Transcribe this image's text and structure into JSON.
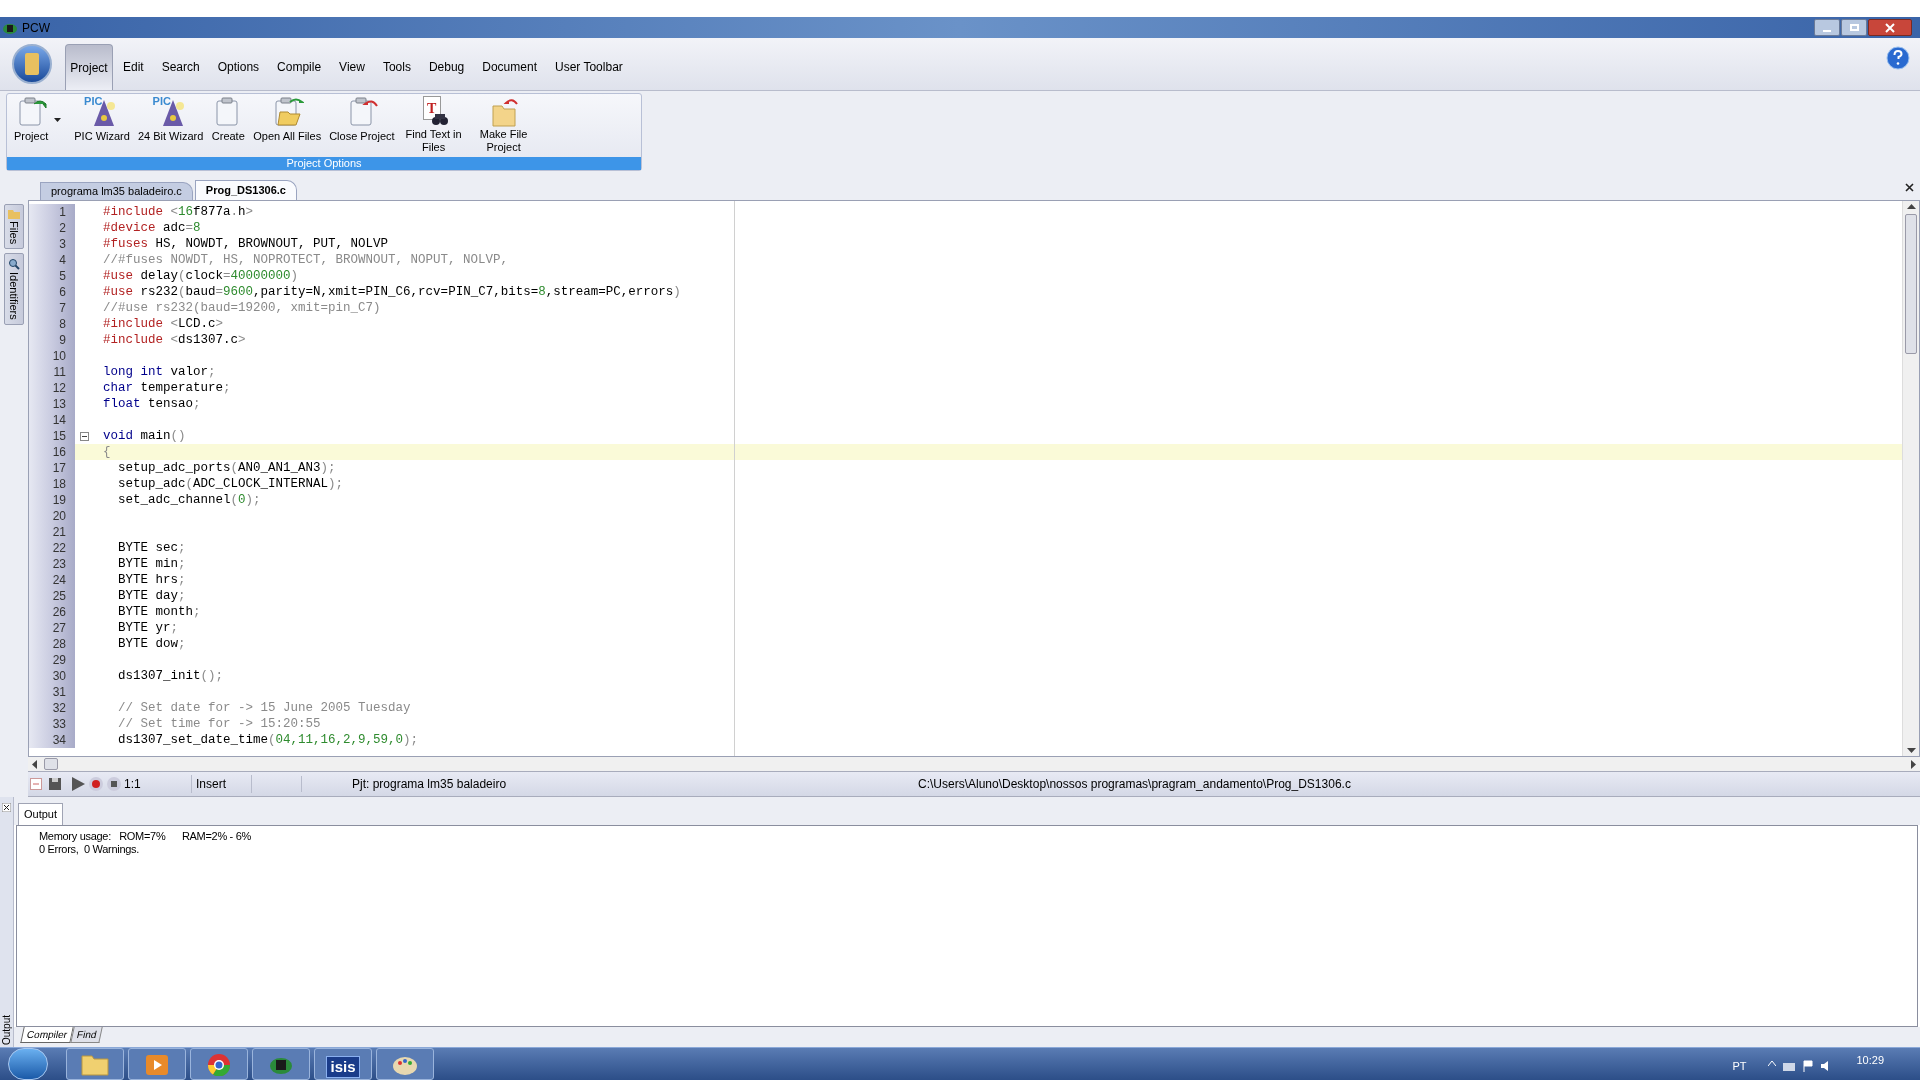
{
  "window": {
    "title": "PCW"
  },
  "ribbon_tabs": [
    {
      "label": "Project",
      "selected": true
    },
    {
      "label": "Edit",
      "selected": false
    },
    {
      "label": "Search",
      "selected": false
    },
    {
      "label": "Options",
      "selected": false
    },
    {
      "label": "Compile",
      "selected": false
    },
    {
      "label": "View",
      "selected": false
    },
    {
      "label": "Tools",
      "selected": false
    },
    {
      "label": "Debug",
      "selected": false
    },
    {
      "label": "Document",
      "selected": false
    },
    {
      "label": "User Toolbar",
      "selected": false
    }
  ],
  "ribbon_group": {
    "label": "Project Options",
    "buttons": [
      {
        "kind": "project",
        "label": "Project",
        "dropdown": true
      },
      {
        "kind": "wizard",
        "label": "PIC Wizard",
        "dropdown": false,
        "badge": "PIC"
      },
      {
        "kind": "wizard",
        "label": "24 Bit Wizard",
        "dropdown": false,
        "badge": "PIC"
      },
      {
        "kind": "create",
        "label": "Create",
        "dropdown": false
      },
      {
        "kind": "open",
        "label": "Open All Files",
        "dropdown": false
      },
      {
        "kind": "close",
        "label": "Close Project",
        "dropdown": false
      },
      {
        "kind": "find",
        "label": "Find Text in Files",
        "dropdown": false,
        "badge": "T"
      },
      {
        "kind": "make",
        "label": "Make File Project",
        "dropdown": false
      }
    ]
  },
  "side_tabs": [
    "Files",
    "Identifiers"
  ],
  "doc_tabs": [
    {
      "label": "programa lm35 baladeiro.c",
      "selected": false
    },
    {
      "label": "Prog_DS1306.c",
      "selected": true
    }
  ],
  "code": [
    {
      "n": "1",
      "current": false,
      "fold": false,
      "tokens": [
        {
          "kind": "dir",
          "t": "#include"
        },
        {
          "kind": "op",
          "t": " <"
        },
        {
          "kind": "num",
          "t": "16"
        },
        {
          "kind": "txt",
          "t": "f877a"
        },
        {
          "kind": "op",
          "t": "."
        },
        {
          "kind": "txt",
          "t": "h"
        },
        {
          "kind": "op",
          "t": ">"
        }
      ]
    },
    {
      "n": "2",
      "current": false,
      "fold": false,
      "tokens": [
        {
          "kind": "dir",
          "t": "#device"
        },
        {
          "kind": "txt",
          "t": " adc"
        },
        {
          "kind": "op",
          "t": "="
        },
        {
          "kind": "num",
          "t": "8"
        }
      ]
    },
    {
      "n": "3",
      "current": false,
      "fold": false,
      "tokens": [
        {
          "kind": "dir",
          "t": "#fuses"
        },
        {
          "kind": "txt",
          "t": " HS, NOWDT, BROWNOUT, PUT, NOLVP"
        }
      ]
    },
    {
      "n": "4",
      "current": false,
      "fold": false,
      "tokens": [
        {
          "kind": "com",
          "t": "//#fuses NOWDT, HS, NOPROTECT, BROWNOUT, NOPUT, NOLVP,"
        }
      ]
    },
    {
      "n": "5",
      "current": false,
      "fold": false,
      "tokens": [
        {
          "kind": "dir",
          "t": "#use"
        },
        {
          "kind": "txt",
          "t": " delay"
        },
        {
          "kind": "op",
          "t": "("
        },
        {
          "kind": "txt",
          "t": "clock"
        },
        {
          "kind": "op",
          "t": "="
        },
        {
          "kind": "num",
          "t": "40000000"
        },
        {
          "kind": "op",
          "t": ")"
        }
      ]
    },
    {
      "n": "6",
      "current": false,
      "fold": false,
      "tokens": [
        {
          "kind": "dir",
          "t": "#use"
        },
        {
          "kind": "txt",
          "t": " rs232"
        },
        {
          "kind": "op",
          "t": "("
        },
        {
          "kind": "txt",
          "t": "baud"
        },
        {
          "kind": "op",
          "t": "="
        },
        {
          "kind": "num",
          "t": "9600"
        },
        {
          "kind": "txt",
          "t": ",parity=N,xmit=PIN_C6,rcv=PIN_C7,bits="
        },
        {
          "kind": "num",
          "t": "8"
        },
        {
          "kind": "txt",
          "t": ",stream=PC,errors"
        },
        {
          "kind": "op",
          "t": ")"
        }
      ]
    },
    {
      "n": "7",
      "current": false,
      "fold": false,
      "tokens": [
        {
          "kind": "com",
          "t": "//#use rs232(baud=19200, xmit=pin_C7)"
        }
      ]
    },
    {
      "n": "8",
      "current": false,
      "fold": false,
      "tokens": [
        {
          "kind": "dir",
          "t": "#include"
        },
        {
          "kind": "op",
          "t": " <"
        },
        {
          "kind": "txt",
          "t": "LCD.c"
        },
        {
          "kind": "op",
          "t": ">"
        }
      ]
    },
    {
      "n": "9",
      "current": false,
      "fold": false,
      "tokens": [
        {
          "kind": "dir",
          "t": "#include"
        },
        {
          "kind": "op",
          "t": " <"
        },
        {
          "kind": "txt",
          "t": "ds1307.c"
        },
        {
          "kind": "op",
          "t": ">"
        }
      ]
    },
    {
      "n": "10",
      "current": false,
      "fold": false
    },
    {
      "n": "11",
      "current": false,
      "fold": false,
      "tokens": [
        {
          "kind": "kw",
          "t": "long"
        },
        {
          "kind": "kw",
          "t": " int"
        },
        {
          "kind": "txt",
          "t": " valor"
        },
        {
          "kind": "op",
          "t": ";"
        }
      ]
    },
    {
      "n": "12",
      "current": false,
      "fold": false,
      "tokens": [
        {
          "kind": "kw",
          "t": "char"
        },
        {
          "kind": "txt",
          "t": " temperature"
        },
        {
          "kind": "op",
          "t": ";"
        }
      ]
    },
    {
      "n": "13",
      "current": false,
      "fold": false,
      "tokens": [
        {
          "kind": "kw",
          "t": "float"
        },
        {
          "kind": "txt",
          "t": " tensao"
        },
        {
          "kind": "op",
          "t": ";"
        }
      ]
    },
    {
      "n": "14",
      "current": false,
      "fold": false
    },
    {
      "n": "15",
      "current": false,
      "fold": true,
      "tokens": [
        {
          "kind": "kw",
          "t": "void"
        },
        {
          "kind": "txt",
          "t": " main"
        },
        {
          "kind": "op",
          "t": "()"
        }
      ]
    },
    {
      "n": "16",
      "current": true,
      "fold": false,
      "tokens": [
        {
          "kind": "op",
          "t": "{"
        }
      ]
    },
    {
      "n": "17",
      "current": false,
      "fold": false,
      "tokens": [
        {
          "kind": "txt",
          "t": "  setup_adc_ports"
        },
        {
          "kind": "op",
          "t": "("
        },
        {
          "kind": "txt",
          "t": "AN0_AN1_AN3"
        },
        {
          "kind": "op",
          "t": ");"
        }
      ]
    },
    {
      "n": "18",
      "current": false,
      "fold": false,
      "tokens": [
        {
          "kind": "txt",
          "t": "  setup_adc"
        },
        {
          "kind": "op",
          "t": "("
        },
        {
          "kind": "txt",
          "t": "ADC_CLOCK_INTERNAL"
        },
        {
          "kind": "op",
          "t": ");"
        }
      ]
    },
    {
      "n": "19",
      "current": false,
      "fold": false,
      "tokens": [
        {
          "kind": "txt",
          "t": "  set_adc_channel"
        },
        {
          "kind": "op",
          "t": "("
        },
        {
          "kind": "num",
          "t": "0"
        },
        {
          "kind": "op",
          "t": ");"
        }
      ]
    },
    {
      "n": "20",
      "current": false,
      "fold": false
    },
    {
      "n": "21",
      "current": false,
      "fold": false
    },
    {
      "n": "22",
      "current": false,
      "fold": false,
      "tokens": [
        {
          "kind": "txt",
          "t": "  BYTE sec"
        },
        {
          "kind": "op",
          "t": ";"
        }
      ]
    },
    {
      "n": "23",
      "current": false,
      "fold": false,
      "tokens": [
        {
          "kind": "txt",
          "t": "  BYTE min"
        },
        {
          "kind": "op",
          "t": ";"
        }
      ]
    },
    {
      "n": "24",
      "current": false,
      "fold": false,
      "tokens": [
        {
          "kind": "txt",
          "t": "  BYTE hrs"
        },
        {
          "kind": "op",
          "t": ";"
        }
      ]
    },
    {
      "n": "25",
      "current": false,
      "fold": false,
      "tokens": [
        {
          "kind": "txt",
          "t": "  BYTE day"
        },
        {
          "kind": "op",
          "t": ";"
        }
      ]
    },
    {
      "n": "26",
      "current": false,
      "fold": false,
      "tokens": [
        {
          "kind": "txt",
          "t": "  BYTE month"
        },
        {
          "kind": "op",
          "t": ";"
        }
      ]
    },
    {
      "n": "27",
      "current": false,
      "fold": false,
      "tokens": [
        {
          "kind": "txt",
          "t": "  BYTE yr"
        },
        {
          "kind": "op",
          "t": ";"
        }
      ]
    },
    {
      "n": "28",
      "current": false,
      "fold": false,
      "tokens": [
        {
          "kind": "txt",
          "t": "  BYTE dow"
        },
        {
          "kind": "op",
          "t": ";"
        }
      ]
    },
    {
      "n": "29",
      "current": false,
      "fold": false
    },
    {
      "n": "30",
      "current": false,
      "fold": false,
      "tokens": [
        {
          "kind": "txt",
          "t": "  ds1307_init"
        },
        {
          "kind": "op",
          "t": "();"
        }
      ]
    },
    {
      "n": "31",
      "current": false,
      "fold": false
    },
    {
      "n": "32",
      "current": false,
      "fold": false,
      "tokens": [
        {
          "kind": "com",
          "t": "  // Set date for -> 15 June 2005 Tuesday"
        }
      ]
    },
    {
      "n": "33",
      "current": false,
      "fold": false,
      "tokens": [
        {
          "kind": "com",
          "t": "  // Set time for -> 15:20:55"
        }
      ]
    },
    {
      "n": "34",
      "current": false,
      "fold": false,
      "tokens": [
        {
          "kind": "txt",
          "t": "  ds1307_set_date_time"
        },
        {
          "kind": "op",
          "t": "("
        },
        {
          "kind": "num",
          "t": "04,11,16,2,9,59,0"
        },
        {
          "kind": "op",
          "t": ");"
        }
      ]
    }
  ],
  "status_bar": {
    "position": "1:1",
    "mode": "Insert",
    "project": "Pjt: programa lm35 baladeiro",
    "path": "C:\\Users\\Aluno\\Desktop\\nossos programas\\pragram_andamento\\Prog_DS1306.c"
  },
  "output": {
    "tab": "Output",
    "side_label": "Output",
    "lines": [
      "Memory usage:   ROM=7%      RAM=2% - 6%",
      "0 Errors,  0 Warnings."
    ],
    "bottom_tabs": [
      {
        "label": "Compiler",
        "selected": true
      },
      {
        "label": "Find",
        "selected": false
      }
    ]
  },
  "taskbar": {
    "apps": [
      {
        "kind": "folder"
      },
      {
        "kind": "media"
      },
      {
        "kind": "browser"
      },
      {
        "kind": "pcw"
      },
      {
        "kind": "isis",
        "label": "isis"
      },
      {
        "kind": "paint"
      }
    ],
    "language": "PT",
    "time": "10:29"
  }
}
